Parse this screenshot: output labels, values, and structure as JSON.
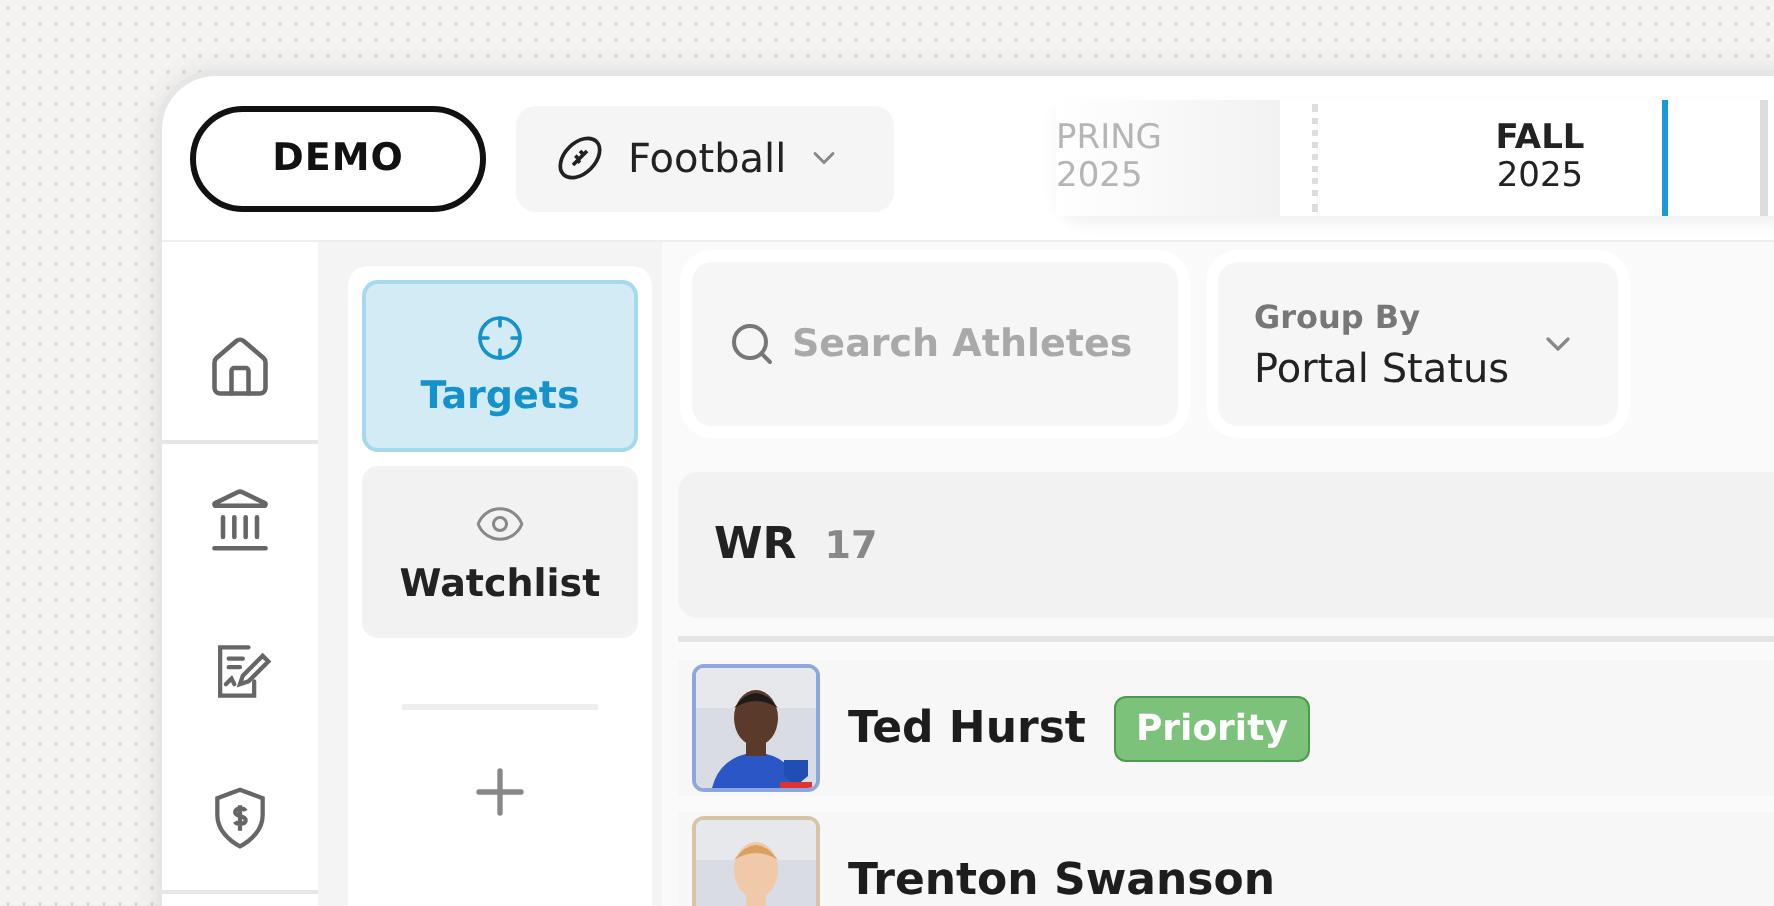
{
  "header": {
    "demo_button": "DEMO",
    "sport": {
      "label": "Football"
    },
    "seasons": [
      {
        "label": "PRING",
        "year": "2025",
        "selected": false
      },
      {
        "label": "FALL",
        "year": "2025",
        "selected": true
      }
    ]
  },
  "nav": {
    "items": [
      {
        "kind": "home"
      },
      {
        "kind": "bank"
      },
      {
        "kind": "sign"
      },
      {
        "kind": "money"
      }
    ]
  },
  "lists": [
    {
      "label": "Targets",
      "kind": "target",
      "selected": true
    },
    {
      "label": "Watchlist",
      "kind": "eye",
      "selected": false
    }
  ],
  "search": {
    "placeholder": "Search Athletes"
  },
  "group_by": {
    "label": "Group By",
    "value": "Portal Status"
  },
  "group": {
    "title": "WR",
    "count": "17"
  },
  "athletes": [
    {
      "name": "Ted Hurst",
      "tag": {
        "label": "Priority",
        "color": "#7cc27a"
      }
    },
    {
      "name": "Trenton Swanson"
    }
  ]
}
